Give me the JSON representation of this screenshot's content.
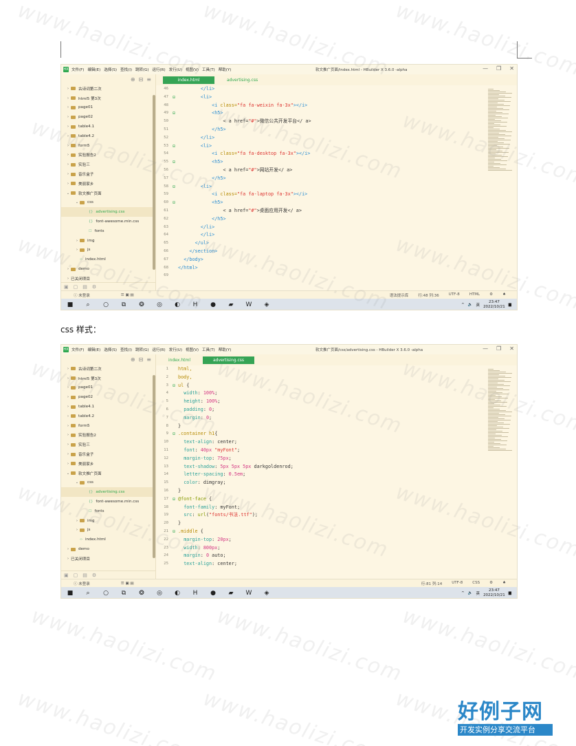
{
  "ide": {
    "app_label": "HX",
    "menu": [
      "文件(F)",
      "编辑(E)",
      "选择(S)",
      "查找(I)",
      "跳转(G)",
      "运行(R)",
      "发行(U)",
      "视图(V)",
      "工具(T)",
      "帮助(Y)"
    ],
    "tree": [
      {
        "label": "古诗词第二次",
        "arrow": "›",
        "icon": "folder",
        "level": 0
      },
      {
        "label": "html5 第3次",
        "arrow": "›",
        "icon": "folder",
        "level": 0
      },
      {
        "label": "page01",
        "arrow": "›",
        "icon": "folder",
        "level": 0
      },
      {
        "label": "page02",
        "arrow": "›",
        "icon": "folder",
        "level": 0
      },
      {
        "label": "table4.1",
        "arrow": "›",
        "icon": "folder",
        "level": 0
      },
      {
        "label": "table4.2",
        "arrow": "›",
        "icon": "folder",
        "level": 0
      },
      {
        "label": "form5",
        "arrow": "›",
        "icon": "folder",
        "level": 0
      },
      {
        "label": "实验报告2",
        "arrow": "›",
        "icon": "folder",
        "level": 0
      },
      {
        "label": "实验三",
        "arrow": "›",
        "icon": "folder",
        "level": 0
      },
      {
        "label": "音乐盒子",
        "arrow": "›",
        "icon": "folder",
        "level": 0
      },
      {
        "label": "美丽家乡",
        "arrow": "›",
        "icon": "folder",
        "level": 0
      },
      {
        "label": "软文推广页面",
        "arrow": "⌄",
        "icon": "folder",
        "level": 0
      },
      {
        "label": "css",
        "arrow": "⌄",
        "icon": "folder",
        "level": 1
      },
      {
        "label": "advertising.css",
        "arrow": "",
        "icon": "{}",
        "level": 2,
        "selected": true
      },
      {
        "label": "font-awesome.min.css",
        "arrow": "",
        "icon": "{}",
        "level": 2
      },
      {
        "label": "fonts",
        "arrow": "",
        "icon": "☐",
        "level": 2
      },
      {
        "label": "img",
        "arrow": "›",
        "icon": "folder",
        "level": 1
      },
      {
        "label": "js",
        "arrow": "›",
        "icon": "folder",
        "level": 1
      },
      {
        "label": "index.html",
        "arrow": "",
        "icon": "‹›",
        "level": 1
      },
      {
        "label": "demo",
        "arrow": "›",
        "icon": "folder",
        "level": 0
      },
      {
        "label": "已关闭项目",
        "arrow": "›",
        "icon": "",
        "level": 0
      }
    ],
    "tabs": [
      "index.html",
      "advertising.css"
    ],
    "login_label": "未登录",
    "clock_time": "23:47",
    "clock_date": "2022/10/21",
    "ime": "英"
  },
  "shot1": {
    "window_title": "软文推广页面/index.html - HBuilder X 3.6.0 -alpha",
    "active_tab": 0,
    "status_hint": "语法提示库",
    "status_pos": "行:48 列:36",
    "status_enc": "UTF-8",
    "status_lang": "HTML",
    "lines": [
      {
        "n": "46",
        "fold": "",
        "indent": "        ",
        "code": [
          [
            "tag",
            "</li>"
          ]
        ]
      },
      {
        "n": "47",
        "fold": "⊟",
        "indent": "        ",
        "code": [
          [
            "tag",
            "<li>"
          ]
        ]
      },
      {
        "n": "48",
        "fold": "",
        "indent": "            ",
        "code": [
          [
            "tag",
            "<i "
          ],
          [
            "attr",
            "class="
          ],
          [
            "str",
            "\"fa fa-weixin fa-3x\""
          ],
          [
            "tag",
            "></i>"
          ]
        ]
      },
      {
        "n": "49",
        "fold": "⊟",
        "indent": "            ",
        "code": [
          [
            "tag",
            "<h5>"
          ]
        ]
      },
      {
        "n": "50",
        "fold": "",
        "indent": "                ",
        "code": [
          [
            "txt",
            "< a href="
          ],
          [
            "str",
            "\"#\""
          ],
          [
            "txt",
            ">微信公共开发平台</ a>"
          ]
        ]
      },
      {
        "n": "51",
        "fold": "",
        "indent": "            ",
        "code": [
          [
            "tag",
            "</h5>"
          ]
        ]
      },
      {
        "n": "52",
        "fold": "",
        "indent": "        ",
        "code": [
          [
            "tag",
            "</li>"
          ]
        ]
      },
      {
        "n": "53",
        "fold": "⊟",
        "indent": "        ",
        "code": [
          [
            "tag",
            "<li>"
          ]
        ]
      },
      {
        "n": "54",
        "fold": "",
        "indent": "            ",
        "code": [
          [
            "tag",
            "<i "
          ],
          [
            "attr",
            "class="
          ],
          [
            "str",
            "\"fa fa-desktop fa-3x\""
          ],
          [
            "tag",
            "></i>"
          ]
        ]
      },
      {
        "n": "55",
        "fold": "⊟",
        "indent": "            ",
        "code": [
          [
            "tag",
            "<h5>"
          ]
        ]
      },
      {
        "n": "56",
        "fold": "",
        "indent": "                ",
        "code": [
          [
            "txt",
            "< a href="
          ],
          [
            "str",
            "\"#\""
          ],
          [
            "txt",
            ">网站开发</ a>"
          ]
        ]
      },
      {
        "n": "57",
        "fold": "",
        "indent": "            ",
        "code": [
          [
            "tag",
            "</h5>"
          ]
        ]
      },
      {
        "n": "58",
        "fold": "⊟",
        "indent": "        ",
        "code": [
          [
            "tag",
            "<li>"
          ]
        ]
      },
      {
        "n": "59",
        "fold": "",
        "indent": "            ",
        "code": [
          [
            "tag",
            "<i "
          ],
          [
            "attr",
            "class="
          ],
          [
            "str",
            "\"fa fa-laptop fa-3x\""
          ],
          [
            "tag",
            "></i>"
          ]
        ]
      },
      {
        "n": "60",
        "fold": "⊟",
        "indent": "            ",
        "code": [
          [
            "tag",
            "<h5>"
          ]
        ]
      },
      {
        "n": "61",
        "fold": "",
        "indent": "                ",
        "code": [
          [
            "txt",
            "< a href="
          ],
          [
            "str",
            "\"#\""
          ],
          [
            "txt",
            ">桌面应用开发</ a>"
          ]
        ]
      },
      {
        "n": "62",
        "fold": "",
        "indent": "            ",
        "code": [
          [
            "tag",
            "</h5>"
          ]
        ]
      },
      {
        "n": "63",
        "fold": "",
        "indent": "        ",
        "code": [
          [
            "tag",
            "</li>"
          ]
        ]
      },
      {
        "n": "64",
        "fold": "",
        "indent": "        ",
        "code": [
          [
            "tag",
            "</li>"
          ]
        ]
      },
      {
        "n": "65",
        "fold": "",
        "indent": "      ",
        "code": [
          [
            "tag",
            "</ul>"
          ]
        ]
      },
      {
        "n": "66",
        "fold": "",
        "indent": "    ",
        "code": [
          [
            "tag",
            "</section>"
          ]
        ]
      },
      {
        "n": "67",
        "fold": "",
        "indent": "  ",
        "code": [
          [
            "tag",
            "</body>"
          ]
        ]
      },
      {
        "n": "68",
        "fold": "",
        "indent": "",
        "code": [
          [
            "tag",
            "</html>"
          ]
        ]
      },
      {
        "n": "69",
        "fold": "",
        "indent": "",
        "code": []
      }
    ]
  },
  "heading": "css 样式：",
  "shot2": {
    "window_title": "软文推广页面/css/advertising.css - HBuilder X 3.6.0 -alpha",
    "active_tab": 1,
    "status_pos": "行:81 列:14",
    "status_enc": "UTF-8",
    "status_lang": "CSS",
    "lines": [
      {
        "n": "1",
        "fold": "",
        "indent": "",
        "code": [
          [
            "sel",
            "html,"
          ]
        ]
      },
      {
        "n": "2",
        "fold": "",
        "indent": "",
        "code": [
          [
            "sel",
            "body,"
          ]
        ]
      },
      {
        "n": "3",
        "fold": "⊟",
        "indent": "",
        "code": [
          [
            "sel",
            "ul "
          ],
          [
            "txt",
            "{"
          ]
        ]
      },
      {
        "n": "4",
        "fold": "",
        "indent": "  ",
        "code": [
          [
            "prop",
            "width"
          ],
          [
            "txt",
            ": "
          ],
          [
            "num",
            "100%"
          ],
          [
            "txt",
            ";"
          ]
        ]
      },
      {
        "n": "5",
        "fold": "",
        "indent": "  ",
        "code": [
          [
            "prop",
            "height"
          ],
          [
            "txt",
            ": "
          ],
          [
            "num",
            "100%"
          ],
          [
            "txt",
            ";"
          ]
        ]
      },
      {
        "n": "6",
        "fold": "",
        "indent": "  ",
        "code": [
          [
            "prop",
            "padding"
          ],
          [
            "txt",
            ": "
          ],
          [
            "num",
            "0"
          ],
          [
            "txt",
            ";"
          ]
        ]
      },
      {
        "n": "7",
        "fold": "",
        "indent": "  ",
        "code": [
          [
            "prop",
            "margin"
          ],
          [
            "txt",
            ": "
          ],
          [
            "num",
            "0"
          ],
          [
            "txt",
            ";"
          ]
        ]
      },
      {
        "n": "8",
        "fold": "",
        "indent": "",
        "code": [
          [
            "txt",
            "}"
          ]
        ]
      },
      {
        "n": "9",
        "fold": "⊟",
        "indent": "",
        "code": [
          [
            "sel",
            ".container h1"
          ],
          [
            "txt",
            "{"
          ]
        ]
      },
      {
        "n": "10",
        "fold": "",
        "indent": "  ",
        "code": [
          [
            "prop",
            "text-align"
          ],
          [
            "txt",
            ": center;"
          ]
        ]
      },
      {
        "n": "11",
        "fold": "",
        "indent": "  ",
        "code": [
          [
            "prop",
            "font"
          ],
          [
            "txt",
            ": "
          ],
          [
            "num",
            "40px "
          ],
          [
            "str",
            "\"myFont\""
          ],
          [
            "txt",
            ";"
          ]
        ]
      },
      {
        "n": "12",
        "fold": "",
        "indent": "  ",
        "code": [
          [
            "prop",
            "margin-top"
          ],
          [
            "txt",
            ": "
          ],
          [
            "num",
            "75px"
          ],
          [
            "txt",
            ";"
          ]
        ]
      },
      {
        "n": "13",
        "fold": "",
        "indent": "  ",
        "code": [
          [
            "prop",
            "text-shadow"
          ],
          [
            "txt",
            ": "
          ],
          [
            "num",
            "5px 5px 5px "
          ],
          [
            "txt",
            "darkgoldenrod;"
          ]
        ]
      },
      {
        "n": "14",
        "fold": "",
        "indent": "  ",
        "code": [
          [
            "prop",
            "letter-spacing"
          ],
          [
            "txt",
            ": "
          ],
          [
            "num",
            "0.5em"
          ],
          [
            "txt",
            ";"
          ]
        ]
      },
      {
        "n": "15",
        "fold": "",
        "indent": "  ",
        "code": [
          [
            "prop",
            "color"
          ],
          [
            "txt",
            ": dimgray;"
          ]
        ]
      },
      {
        "n": "16",
        "fold": "",
        "indent": "",
        "code": [
          [
            "txt",
            "}"
          ]
        ]
      },
      {
        "n": "17",
        "fold": "⊟",
        "indent": "",
        "code": [
          [
            "kw",
            "@font-face "
          ],
          [
            "txt",
            "{"
          ]
        ]
      },
      {
        "n": "18",
        "fold": "",
        "indent": "  ",
        "code": [
          [
            "prop",
            "font-family"
          ],
          [
            "txt",
            ": myFont;"
          ]
        ]
      },
      {
        "n": "19",
        "fold": "",
        "indent": "  ",
        "code": [
          [
            "prop",
            "src"
          ],
          [
            "txt",
            ": "
          ],
          [
            "kw",
            "url"
          ],
          [
            "txt",
            "("
          ],
          [
            "str",
            "\"fonts/书法.ttf\""
          ],
          [
            "txt",
            ");"
          ]
        ]
      },
      {
        "n": "20",
        "fold": "",
        "indent": "",
        "code": [
          [
            "txt",
            "}"
          ]
        ]
      },
      {
        "n": "21",
        "fold": "⊟",
        "indent": "",
        "code": [
          [
            "sel",
            ".middle "
          ],
          [
            "txt",
            "{"
          ]
        ]
      },
      {
        "n": "22",
        "fold": "",
        "indent": "  ",
        "code": [
          [
            "prop",
            "margin-top"
          ],
          [
            "txt",
            ": "
          ],
          [
            "num",
            "20px"
          ],
          [
            "txt",
            ";"
          ]
        ]
      },
      {
        "n": "23",
        "fold": "",
        "indent": "  ",
        "code": [
          [
            "prop",
            "width"
          ],
          [
            "txt",
            ": "
          ],
          [
            "num",
            "800px"
          ],
          [
            "txt",
            ";"
          ]
        ]
      },
      {
        "n": "24",
        "fold": "",
        "indent": "  ",
        "code": [
          [
            "prop",
            "margin"
          ],
          [
            "txt",
            ": "
          ],
          [
            "num",
            "0"
          ],
          [
            "txt",
            " auto;"
          ]
        ]
      },
      {
        "n": "25",
        "fold": "",
        "indent": "  ",
        "code": [
          [
            "prop",
            "text-align"
          ],
          [
            "txt",
            ": center;"
          ]
        ]
      }
    ]
  },
  "watermark": "www.haolizi.com",
  "brand": {
    "title": "好例子网",
    "subtitle": "开发实例分享交流平台"
  }
}
